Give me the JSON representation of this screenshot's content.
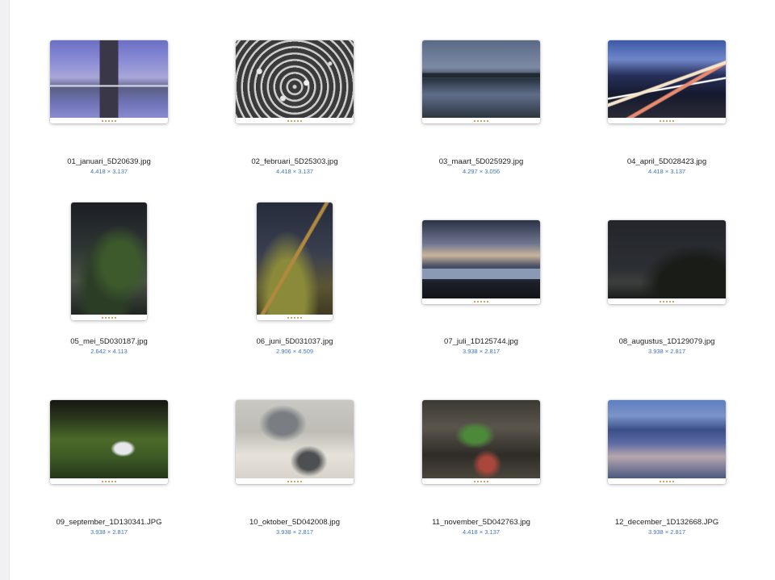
{
  "photos": [
    {
      "filename": "01_januari_5D20639.jpg",
      "dimensions": "4.418 × 3.137"
    },
    {
      "filename": "02_februari_5D25303.jpg",
      "dimensions": "4.418 × 3.137"
    },
    {
      "filename": "03_maart_5D025929.jpg",
      "dimensions": "4.297 × 3.056"
    },
    {
      "filename": "04_april_5D028423.jpg",
      "dimensions": "4.418 × 3.137"
    },
    {
      "filename": "05_mei_5D030187.jpg",
      "dimensions": "2.642 × 4.113"
    },
    {
      "filename": "06_juni_5D031037.jpg",
      "dimensions": "2.906 × 4.509"
    },
    {
      "filename": "07_juli_1D125744.jpg",
      "dimensions": "3.938 × 2.817"
    },
    {
      "filename": "08_augustus_1D129079.jpg",
      "dimensions": "3.938 × 2.817"
    },
    {
      "filename": "09_september_1D130341.JPG",
      "dimensions": "3.938 × 2.817"
    },
    {
      "filename": "10_oktober_5D042008.jpg",
      "dimensions": "3.938 × 2.817"
    },
    {
      "filename": "11_november_5D042763.jpg",
      "dimensions": "4.418 × 3.137"
    },
    {
      "filename": "12_december_1D132668.JPG",
      "dimensions": "3.938 × 2.817"
    }
  ]
}
